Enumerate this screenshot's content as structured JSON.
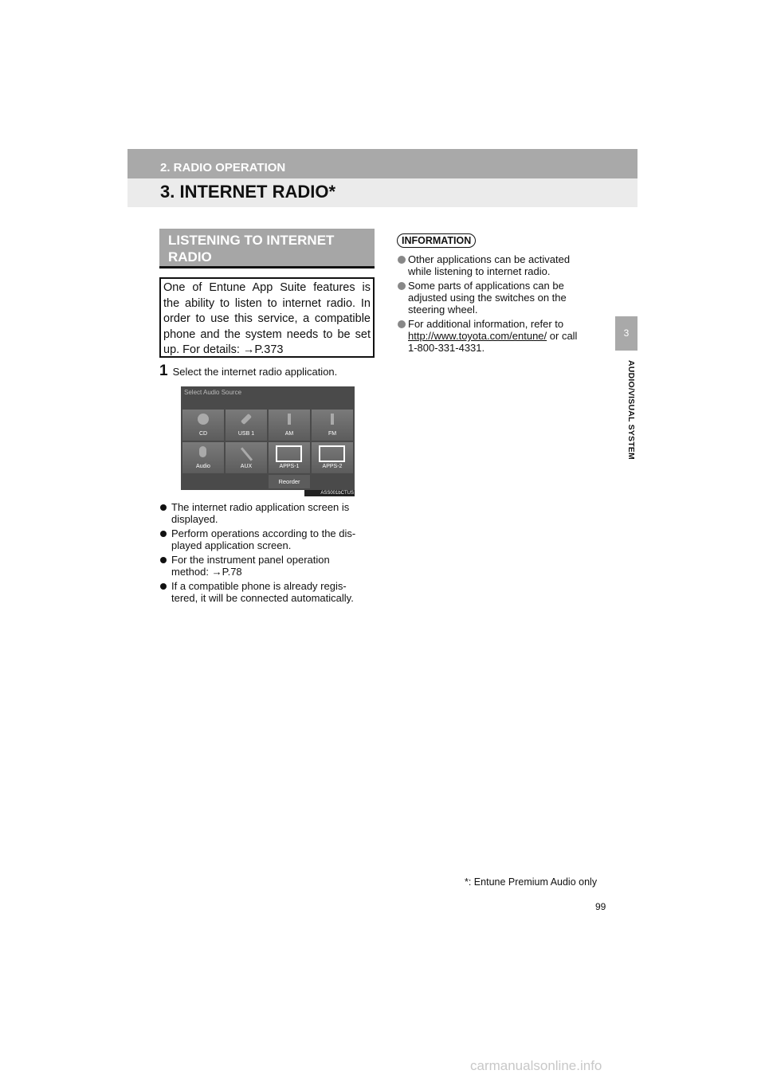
{
  "header": {
    "chapter": "2. RADIO OPERATION",
    "title": "3. INTERNET RADIO*"
  },
  "side_tab": {
    "number": "3",
    "label": "AUDIO/VISUAL SYSTEM"
  },
  "section": {
    "heading": "LISTENING TO INTERNET\nRADIO",
    "intro": [
      "One of Entune App Suite features is",
      "the ability to listen to internet radio. In",
      "order to use this service, a compatible",
      "phone and the system needs to be set",
      "up. For details: →P.373"
    ]
  },
  "step": {
    "number": "1",
    "text": "Select the internet radio application."
  },
  "screenshot": {
    "title": "Select Audio Source",
    "tiles": [
      "CD",
      "USB 1",
      "AM",
      "FM",
      "Audio",
      "AUX",
      "APPS-1",
      "APPS-2"
    ],
    "reorder": "Reorder",
    "code": "ASS001bCTUS"
  },
  "bullets": [
    "The internet radio application screen is\ndisplayed.",
    "Perform operations according to the dis-\nplayed application screen.",
    "For the instrument panel operation\nmethod: →P.78",
    "If a compatible phone is already regis-\ntered, it will be connected automatically."
  ],
  "information": {
    "badge": "INFORMATION",
    "items": [
      "Other applications can be activated\nwhile listening to internet radio.",
      "Some parts of applications can be\nadjusted using the switches on the\nsteering wheel."
    ],
    "last": {
      "pre": "For additional information, refer to",
      "link": "http://www.toyota.com/entune/",
      "post": " or call",
      "phone": "1-800-331-4331."
    }
  },
  "footnote": "*: Entune Premium Audio only",
  "page_number": "99",
  "watermark": "carmanualsonline.info"
}
